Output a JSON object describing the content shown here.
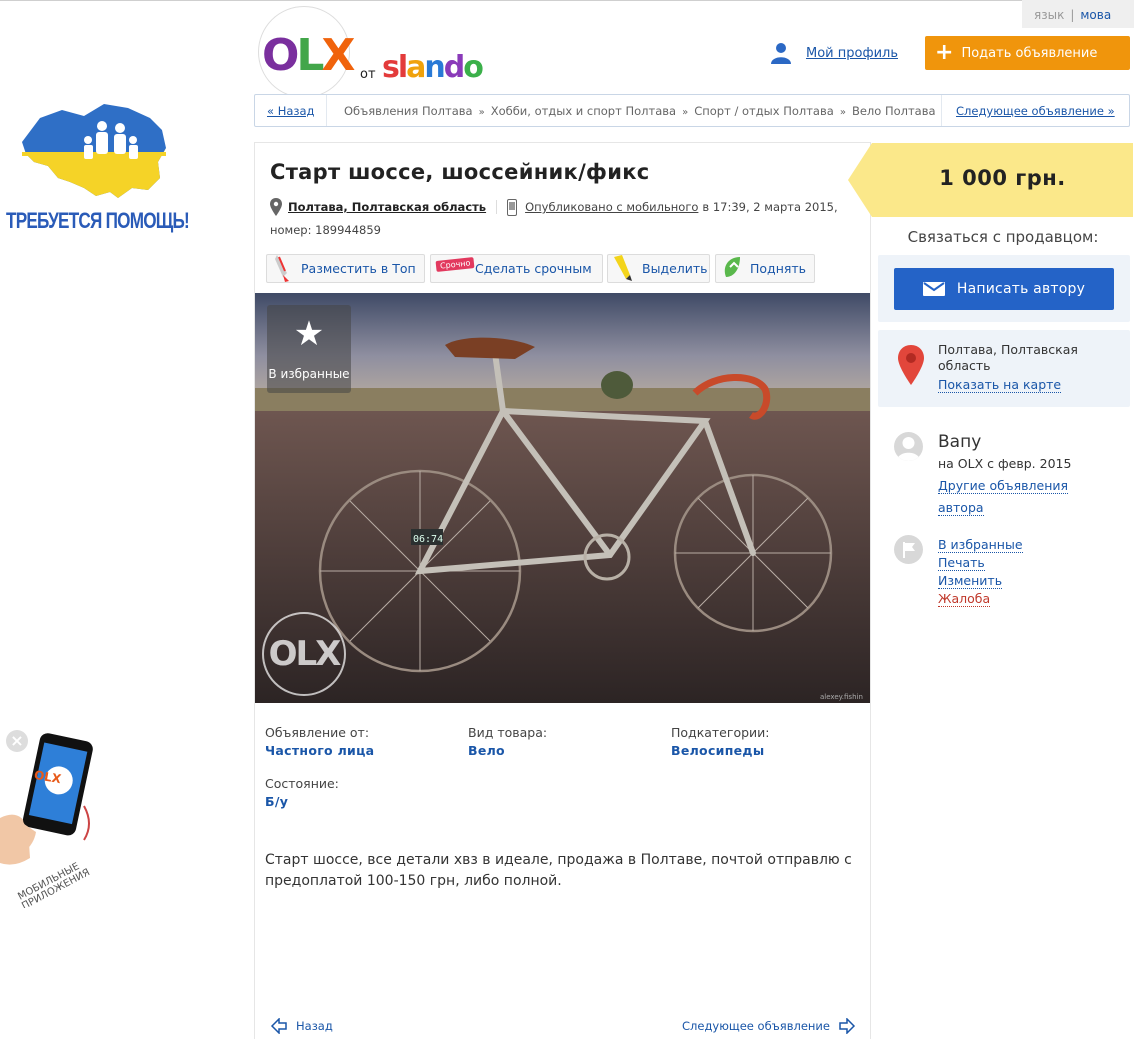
{
  "lang": {
    "label": "язык",
    "link": "мова"
  },
  "logo": {
    "brand": "OLX",
    "from": "от",
    "slando": "slando"
  },
  "header": {
    "profile": "Мой профиль",
    "post_ad": "Подать объявление"
  },
  "breadcrumb": {
    "back": "« Назад",
    "items": [
      "Объявления Полтава",
      "Хобби, отдых и спорт Полтава",
      "Спорт / отдых Полтава",
      "Вело Полтава"
    ],
    "next": "Следующее объявление »"
  },
  "left_banners": {
    "help": "ТРЕБУЕТСЯ ПОМОЩЬ!",
    "mobile_line1": "МОБИЛЬНЫЕ",
    "mobile_line2": "ПРИЛОЖЕНИЯ",
    "mobile_brand": "OLX"
  },
  "ad": {
    "title": "Старт шоссе, шоссейник/фикс",
    "city": "Полтава, Полтавская область",
    "published_link": "Опубликовано с мобильного",
    "published_time": "в 17:39, 2 марта 2015,",
    "number": "номер: 189944859",
    "promo": {
      "top": "Разместить в Топ",
      "urgent": "Сделать срочным",
      "urgent_badge": "Срочно",
      "highlight": "Выделить",
      "raise": "Поднять"
    },
    "favorite": "В избранные",
    "watermark": "OLX",
    "params": [
      {
        "label": "Объявление от:",
        "value": "Частного лица"
      },
      {
        "label": "Вид товара:",
        "value": "Вело"
      },
      {
        "label": "Подкатегории:",
        "value": "Велосипеды"
      },
      {
        "label": "Состояние:",
        "value": "Б/у"
      }
    ],
    "description": "Старт шоссе, все детали хвз в идеале, продажа в Полтаве, почтой отправлю с предоплатой 100-150 грн, либо полной.",
    "bottom_back": "Назад",
    "bottom_next": "Следующее объявление"
  },
  "sidebar": {
    "price": "1 000 грн.",
    "contact_label": "Связаться с продавцом:",
    "write_button": "Написать автору",
    "location": "Полтава, Полтавская область",
    "show_map": "Показать на карте",
    "user_name": "Вапу",
    "user_since": "на OLX с февр. 2015",
    "other_ads_1": "Другие объявления",
    "other_ads_2": "автора",
    "actions": {
      "favorite": "В избранные",
      "print": "Печать",
      "edit": "Изменить",
      "complain": "Жалоба"
    }
  },
  "colors": {
    "accent_orange": "#f0950c",
    "link_blue": "#1a56a8",
    "button_blue": "#2463c7",
    "price_yellow": "#fbe88a",
    "complain_red": "#c0392b"
  }
}
